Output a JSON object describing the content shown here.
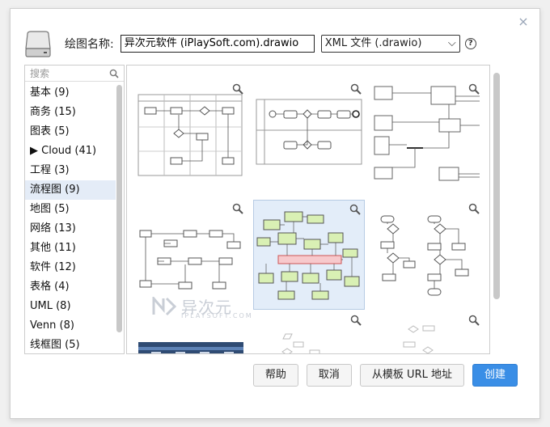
{
  "dialog": {
    "close_icon": "×",
    "name_label": "绘图名称:",
    "name_value": "异次元软件 (iPlaySoft.com).drawio",
    "format_value": "XML 文件 (.drawio)",
    "format_caret": "⌵",
    "help_glyph": "?"
  },
  "sidebar": {
    "search_placeholder": "搜索",
    "categories": [
      {
        "label": "基本 (9)"
      },
      {
        "label": "商务 (15)"
      },
      {
        "label": "图表 (5)"
      },
      {
        "label": "▶ Cloud (41)"
      },
      {
        "label": "工程 (3)"
      },
      {
        "label": "流程图 (9)",
        "active": true
      },
      {
        "label": "地图 (5)"
      },
      {
        "label": "网络 (13)"
      },
      {
        "label": "其他 (11)"
      },
      {
        "label": "软件 (12)"
      },
      {
        "label": "表格 (4)"
      },
      {
        "label": "UML (8)"
      },
      {
        "label": "Venn (8)"
      },
      {
        "label": "线框图 (5)"
      }
    ]
  },
  "watermark": {
    "text": "异次元",
    "sub": "IPLAYSOFT.COM"
  },
  "footer": {
    "help": "帮助",
    "cancel": "取消",
    "from_template_url": "从模板 URL 地址",
    "create": "创建"
  },
  "colors": {
    "accent": "#3a8ee6",
    "selected_bg": "#e3edf9",
    "diagram_green": "#d9f0b4",
    "diagram_pink": "#f7c9cc"
  },
  "icons": [
    "disk-icon",
    "search-icon",
    "zoom-icon",
    "help-icon",
    "close-icon"
  ]
}
